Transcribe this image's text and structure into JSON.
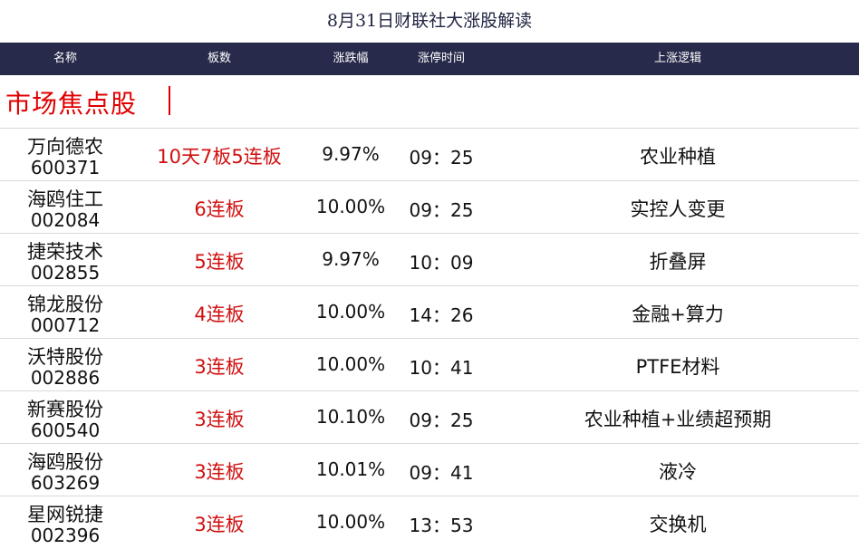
{
  "title": "8月31日财联社大涨股解读",
  "columns": {
    "name": "名称",
    "boards": "板数",
    "change": "涨跌幅",
    "limit_time": "涨停时间",
    "logic": "上涨逻辑"
  },
  "section": {
    "label": "市场焦点股"
  },
  "rows": [
    {
      "name": "万向德农",
      "code": "600371",
      "boards": "10天7板5连板",
      "change": "9.97%",
      "time": "09：25",
      "logic": "农业种植"
    },
    {
      "name": "海鸥住工",
      "code": "002084",
      "boards": "6连板",
      "change": "10.00%",
      "time": "09：25",
      "logic": "实控人变更"
    },
    {
      "name": "捷荣技术",
      "code": "002855",
      "boards": "5连板",
      "change": "9.97%",
      "time": "10：09",
      "logic": "折叠屏"
    },
    {
      "name": "锦龙股份",
      "code": "000712",
      "boards": "4连板",
      "change": "10.00%",
      "time": "14：26",
      "logic": "金融+算力"
    },
    {
      "name": "沃特股份",
      "code": "002886",
      "boards": "3连板",
      "change": "10.00%",
      "time": "10：41",
      "logic": "PTFE材料"
    },
    {
      "name": "新赛股份",
      "code": "600540",
      "boards": "3连板",
      "change": "10.10%",
      "time": "09：25",
      "logic": "农业种植+业绩超预期"
    },
    {
      "name": "海鸥股份",
      "code": "603269",
      "boards": "3连板",
      "change": "10.01%",
      "time": "09：41",
      "logic": "液冷"
    },
    {
      "name": "星网锐捷",
      "code": "002396",
      "boards": "3连板",
      "change": "10.00%",
      "time": "13：53",
      "logic": "交换机"
    }
  ]
}
